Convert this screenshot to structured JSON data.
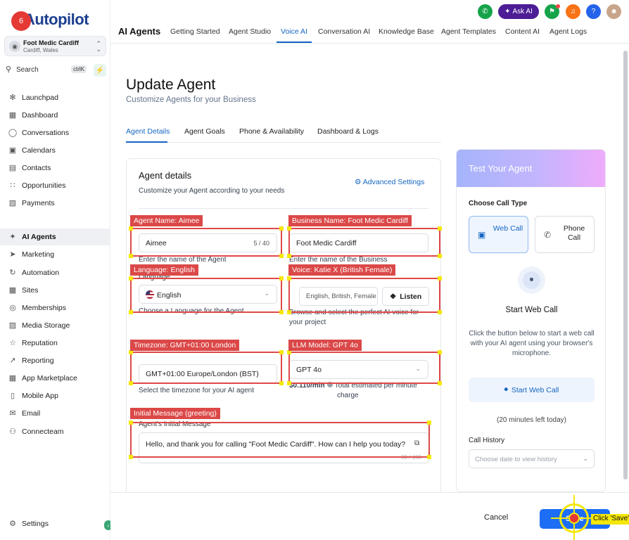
{
  "app": {
    "logo_text": "Autopilot",
    "step_badge": "6"
  },
  "location": {
    "name": "Foot Medic Cardiff",
    "sub": "Cardiff, Wales"
  },
  "search": {
    "label": "Search",
    "shortcut": "ctrlK"
  },
  "sidebar": {
    "items": [
      {
        "label": "Launchpad",
        "icon": "rocket-icon"
      },
      {
        "label": "Dashboard",
        "icon": "grid-icon"
      },
      {
        "label": "Conversations",
        "icon": "chat-icon"
      },
      {
        "label": "Calendars",
        "icon": "calendar-icon"
      },
      {
        "label": "Contacts",
        "icon": "contact-icon"
      },
      {
        "label": "Opportunities",
        "icon": "funnel-icon"
      },
      {
        "label": "Payments",
        "icon": "payment-icon"
      },
      {
        "label": "AI Agents",
        "icon": "sparkle-icon",
        "active": true
      },
      {
        "label": "Marketing",
        "icon": "send-icon"
      },
      {
        "label": "Automation",
        "icon": "automation-icon"
      },
      {
        "label": "Sites",
        "icon": "sites-icon"
      },
      {
        "label": "Memberships",
        "icon": "membership-icon"
      },
      {
        "label": "Media Storage",
        "icon": "image-icon"
      },
      {
        "label": "Reputation",
        "icon": "star-icon"
      },
      {
        "label": "Reporting",
        "icon": "chart-icon"
      },
      {
        "label": "App Marketplace",
        "icon": "apps-icon"
      },
      {
        "label": "Mobile App",
        "icon": "mobile-icon"
      },
      {
        "label": "Email",
        "icon": "email-icon"
      },
      {
        "label": "Connecteam",
        "icon": "team-icon"
      }
    ],
    "settings_label": "Settings"
  },
  "topbar": {
    "title": "AI Agents",
    "tabs": [
      "Getting Started",
      "Agent Studio",
      "Voice AI",
      "Conversation AI",
      "Knowledge Base",
      "Agent Templates",
      "Content AI",
      "Agent Logs"
    ],
    "active_tab": "Voice AI",
    "ask_ai": "Ask AI",
    "help": "?"
  },
  "page": {
    "title": "Update Agent",
    "subtitle": "Customize Agents for your Business",
    "subtabs": [
      "Agent Details",
      "Agent Goals",
      "Phone & Availability",
      "Dashboard & Logs"
    ]
  },
  "details": {
    "title": "Agent details",
    "subtitle": "Customize your Agent according to your needs",
    "advanced": "Advanced Settings",
    "agent_name": {
      "value": "Aimee",
      "count": "5 / 40",
      "hint": "Enter the name of the Agent"
    },
    "business_name": {
      "value": "Foot Medic Cardiff",
      "hint": "Enter the name of the Business"
    },
    "language": {
      "label": "Language",
      "value": "English",
      "hint": "Choose a Language for the Agent"
    },
    "voice": {
      "value": "English, British, Female",
      "listen": "Listen",
      "hint1": "Browse and select the perfect AI voice for",
      "hint2": "your project"
    },
    "timezone": {
      "value": "GMT+01:00 Europe/London (BST)",
      "hint": "Select the timezone for your AI agent"
    },
    "llm": {
      "value": "GPT 4o",
      "price": "$0.110/min",
      "hint1": "Total estimated per minute",
      "hint2": "charge"
    },
    "initial_message": {
      "label": "Agent's Initial Message",
      "value": "Hello, and thank you for calling \"Foot Medic Cardiff\". How can I help you today?",
      "count": "80 / 180"
    }
  },
  "test": {
    "title": "Test Your Agent",
    "call_type_label": "Choose Call Type",
    "web_call": "Web Call",
    "phone_call": "Phone Call",
    "start_title": "Start Web Call",
    "start_desc": "Click the button below to start a web call with your AI agent using your browser's microphone.",
    "start_btn": "Start Web Call",
    "minutes_left": "(20 minutes left today)",
    "history_label": "Call History",
    "history_placeholder": "Choose date to view history"
  },
  "footer": {
    "cancel": "Cancel",
    "save": "Save"
  },
  "annotations": {
    "agent_name": "Agent Name: Aimee",
    "business_name": "Business Name: Foot Medic Cardiff",
    "language": "Language: English",
    "voice": "Voice: Katie X (British Female)",
    "timezone": "Timezone: GMT+01:00 London",
    "llm": "LLM Model: GPT 4o",
    "initial_message": "Initial Message (greeting)",
    "click": "Click 'Save'"
  },
  "colors": {
    "accent": "#1565c0",
    "save": "#1d6ef5",
    "annotation": "#db4848",
    "marker": "#f5e70a"
  }
}
